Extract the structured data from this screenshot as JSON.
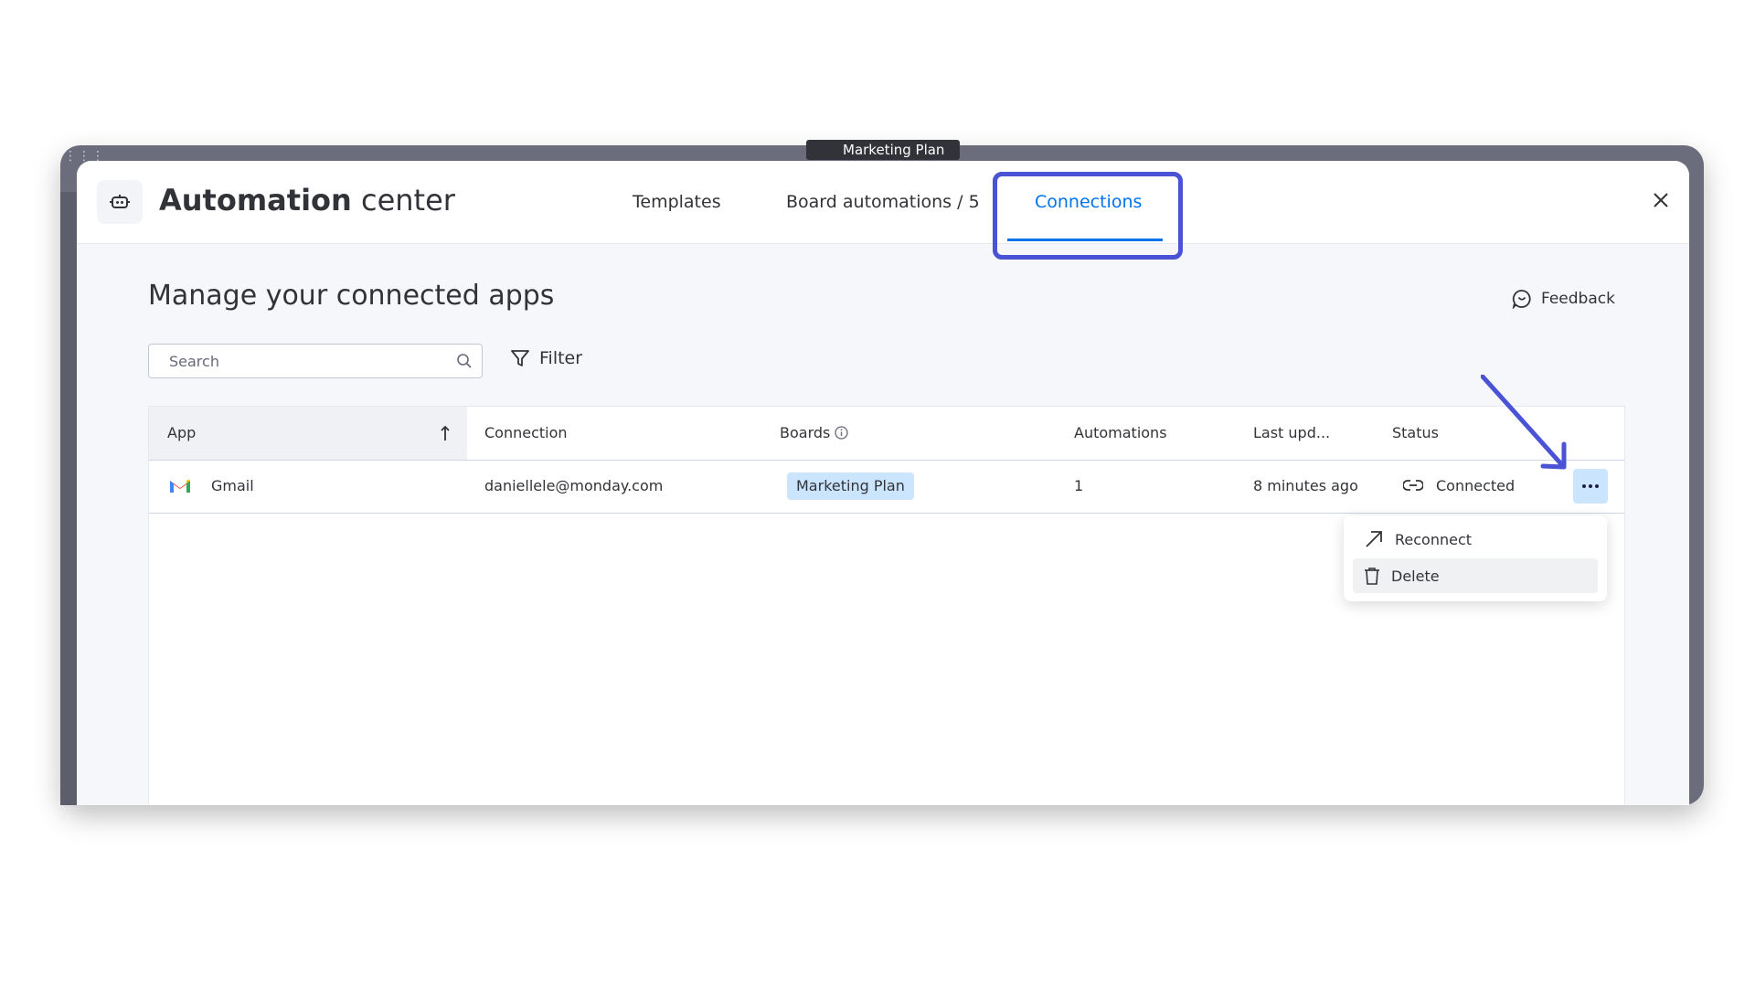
{
  "background": {
    "board_chip": "Marketing Plan"
  },
  "header": {
    "title_bold": "Automation",
    "title_light": " center",
    "tabs": [
      {
        "label": "Templates"
      },
      {
        "label": "Board automations / 5"
      },
      {
        "label": "Connections",
        "active": true
      }
    ]
  },
  "main": {
    "heading": "Manage your connected apps",
    "feedback_label": "Feedback",
    "search_placeholder": "Search",
    "filter_label": "Filter"
  },
  "table": {
    "columns": [
      "App",
      "Connection",
      "Boards",
      "Automations",
      "Last upd...",
      "Status"
    ],
    "rows": [
      {
        "app": "Gmail",
        "connection": "daniellele@monday.com",
        "board": "Marketing Plan",
        "automations": "1",
        "last_updated": "8 minutes ago",
        "status": "Connected"
      }
    ]
  },
  "menu": {
    "items": [
      {
        "label": "Reconnect"
      },
      {
        "label": "Delete"
      }
    ]
  },
  "colors": {
    "accent": "#0073ea",
    "highlight": "#4a52d6",
    "tag_bg": "#cce5ff"
  }
}
